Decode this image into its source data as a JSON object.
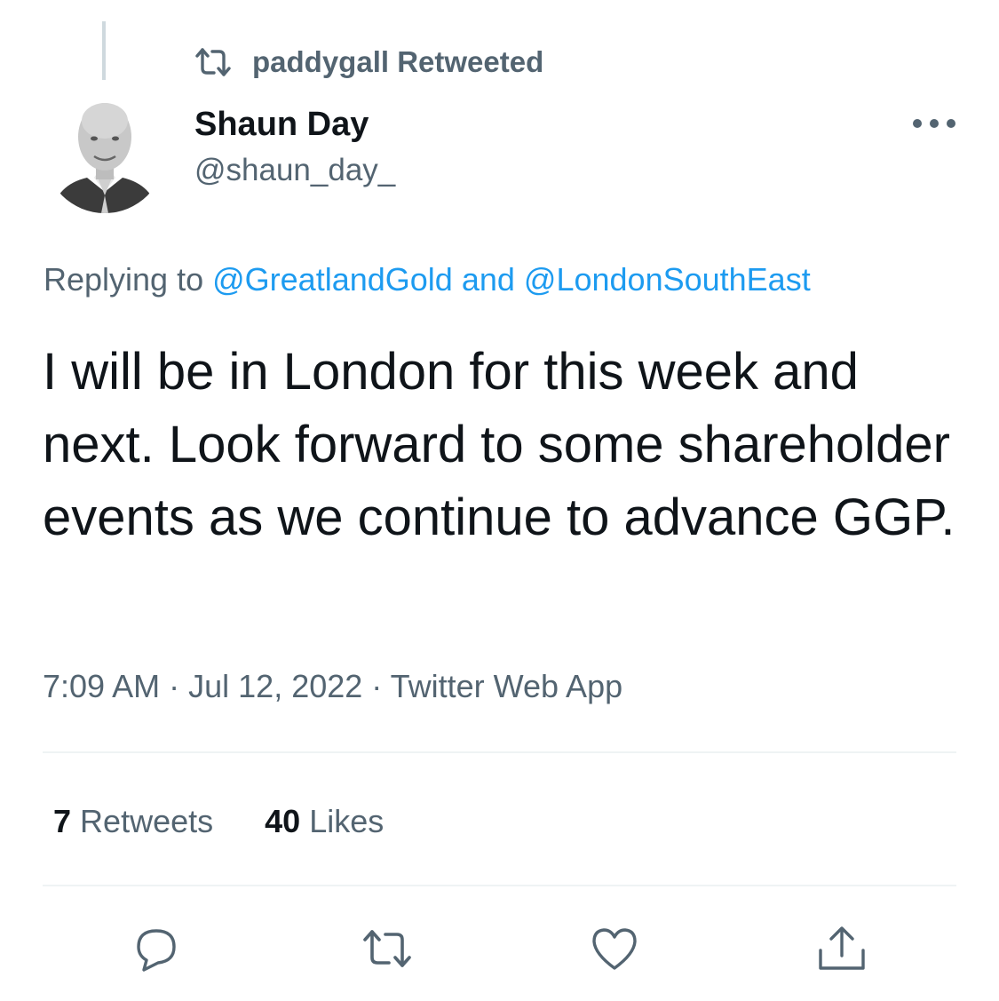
{
  "retweet_context": {
    "icon": "retweet-icon",
    "text": "paddygall Retweeted"
  },
  "author": {
    "name": "Shaun Day",
    "handle": "@shaun_day_",
    "avatar": "profile-photo"
  },
  "more_icon": "more-options-icon",
  "replying": {
    "prefix": "Replying to",
    "mention_1": "@GreatlandGold",
    "joiner": "and",
    "mention_2": "@LondonSouthEast"
  },
  "tweet": {
    "text": "I will be in London for this week and next. Look forward to some shareholder events as we continue to advance GGP."
  },
  "meta": {
    "time": "7:09 AM",
    "date": "Jul 12, 2022",
    "source": "Twitter Web App",
    "separator": "·"
  },
  "stats": {
    "retweets_count": "7",
    "retweets_label": "Retweets",
    "likes_count": "40",
    "likes_label": "Likes"
  },
  "actions": [
    "reply-icon",
    "retweet-icon",
    "like-icon",
    "share-icon"
  ],
  "colors": {
    "text_primary": "#0f1419",
    "text_secondary": "#536471",
    "link": "#1d9bf0",
    "divider": "#eff3f4"
  }
}
